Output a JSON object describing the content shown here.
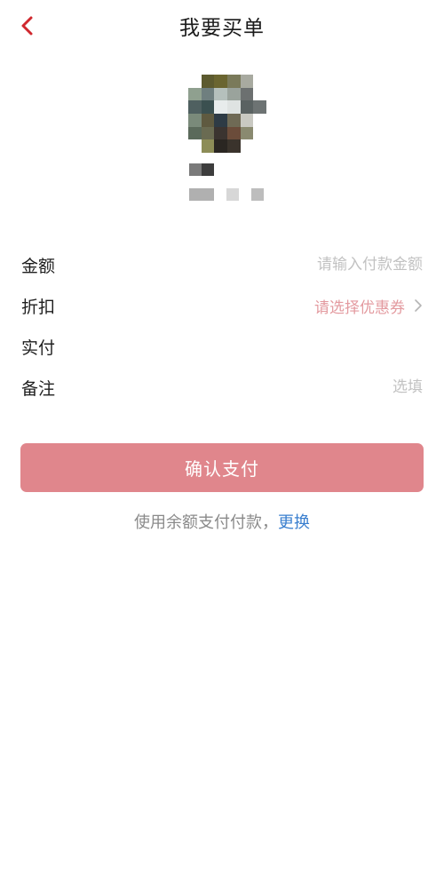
{
  "header": {
    "title": "我要买单"
  },
  "icons": {
    "back": "chevron-left-icon",
    "chevron": "chevron-right-icon"
  },
  "form": {
    "amount_label": "金额",
    "amount_placeholder": "请输入付款金额",
    "discount_label": "折扣",
    "discount_value": "请选择优惠券",
    "actual_label": "实付",
    "actual_value": "",
    "note_label": "备注",
    "note_placeholder": "选填"
  },
  "confirm_button": "确认支付",
  "payment": {
    "method_text": "使用余额支付付款，",
    "change_link": "更换"
  },
  "colors": {
    "accent_red": "#d0282e",
    "button_bg": "#e0868c",
    "link_blue": "#3a7fcf",
    "coupon_text": "#e39a9f"
  }
}
